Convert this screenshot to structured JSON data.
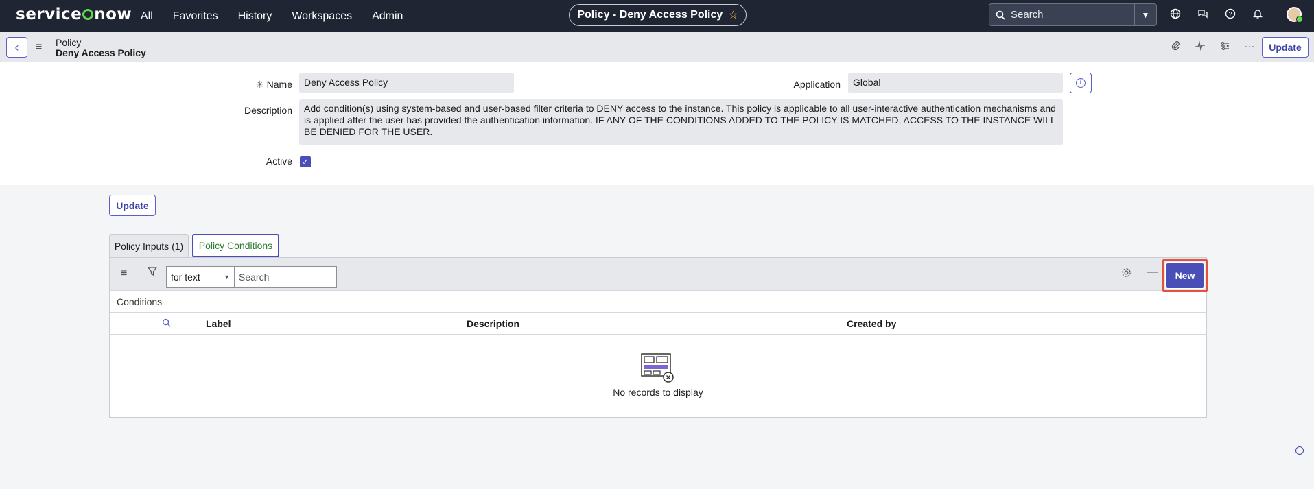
{
  "topnav": {
    "logo": "servicenow",
    "links": [
      "All",
      "Favorites",
      "History",
      "Workspaces",
      "Admin"
    ],
    "record_title": "Policy - Deny Access Policy",
    "search_placeholder": "Search"
  },
  "record_header": {
    "type": "Policy",
    "name": "Deny Access Policy",
    "update_label": "Update"
  },
  "form": {
    "name_label": "Name",
    "name_value": "Deny Access Policy",
    "application_label": "Application",
    "application_value": "Global",
    "description_label": "Description",
    "description_value": "Add condition(s) using system-based and user-based filter criteria to DENY access to the instance. This policy is applicable to all user-interactive authentication mechanisms and is applied after the user has provided the authentication information. IF ANY OF THE CONDITIONS ADDED TO THE POLICY IS MATCHED, ACCESS TO THE INSTANCE WILL BE DENIED FOR THE USER.",
    "active_label": "Active",
    "active_checked": true,
    "update_label": "Update"
  },
  "tabs": [
    {
      "label": "Policy Inputs (1)",
      "selected": false
    },
    {
      "label": "Policy Conditions",
      "selected": true
    }
  ],
  "list": {
    "filter_select": "for text",
    "search_placeholder": "Search",
    "new_label": "New",
    "title": "Conditions",
    "columns": [
      "Label",
      "Description",
      "Created by"
    ],
    "empty_text": "No records to display"
  },
  "colors": {
    "nav_bg": "#1f2533",
    "accent": "#4a4fb8",
    "highlight": "#e2533e",
    "logo_green": "#62d84e"
  }
}
